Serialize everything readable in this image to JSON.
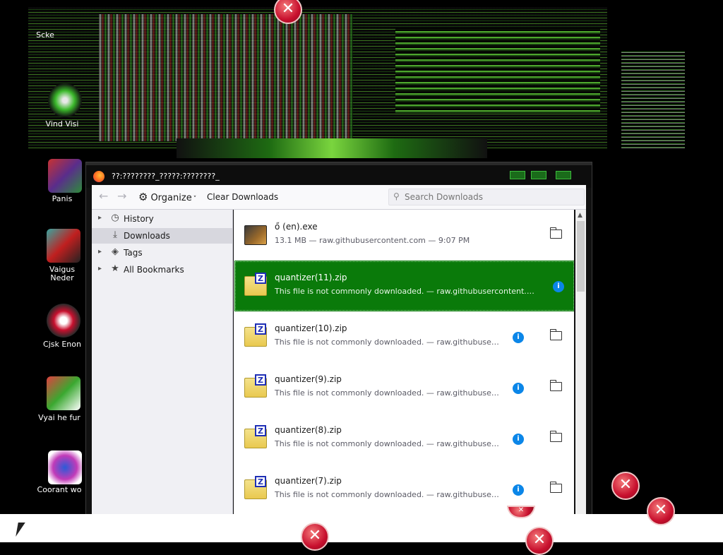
{
  "window": {
    "title": "??:????????_?????:????????_"
  },
  "toolbar": {
    "back_icon": "arrow-left-icon",
    "forward_icon": "arrow-right-icon",
    "organize_label": "Organize",
    "organize_chevron": "˅",
    "clear_label": "Clear Downloads",
    "search_placeholder": "Search Downloads"
  },
  "sidebar": {
    "items": [
      {
        "label": "History",
        "icon": "clock-icon",
        "twisty": true,
        "selected": false
      },
      {
        "label": "Downloads",
        "icon": "download-icon",
        "twisty": false,
        "selected": true
      },
      {
        "label": "Tags",
        "icon": "tag-icon",
        "twisty": true,
        "selected": false
      },
      {
        "label": "All Bookmarks",
        "icon": "star-icon",
        "twisty": true,
        "selected": false
      }
    ]
  },
  "downloads": [
    {
      "name": "ő (en).exe",
      "status": "13.1 MB — raw.githubusercontent.com — 9:07 PM",
      "type": "exe",
      "info": false,
      "selected": false
    },
    {
      "name": "quantizer(11).zip",
      "status": "This file is not commonly downloaded. — raw.githubusercontent.com ...",
      "type": "zip",
      "info": true,
      "selected": true
    },
    {
      "name": "quantizer(10).zip",
      "status": "This file is not commonly downloaded. — raw.githubuserco...",
      "type": "zip",
      "info": true,
      "selected": false
    },
    {
      "name": "quantizer(9).zip",
      "status": "This file is not commonly downloaded. — raw.githubuserco...",
      "type": "zip",
      "info": true,
      "selected": false
    },
    {
      "name": "quantizer(8).zip",
      "status": "This file is not commonly downloaded. — raw.githubuserco...",
      "type": "zip",
      "info": true,
      "selected": false
    },
    {
      "name": "quantizer(7).zip",
      "status": "This file is not commonly downloaded. — raw.githubuserco...",
      "type": "zip",
      "info": true,
      "selected": false
    }
  ],
  "desktop": {
    "labels": [
      "Scke",
      "Vind\nVisi",
      "Panis",
      "Vaigus\nNeder",
      "Cjsk\nEnon",
      "Vyai he fur",
      "Coorant wo"
    ]
  },
  "colors": {
    "selected_row": "#0a7a0a",
    "info_badge": "#0b86e8",
    "glitch_green": "#3dbb3d"
  }
}
